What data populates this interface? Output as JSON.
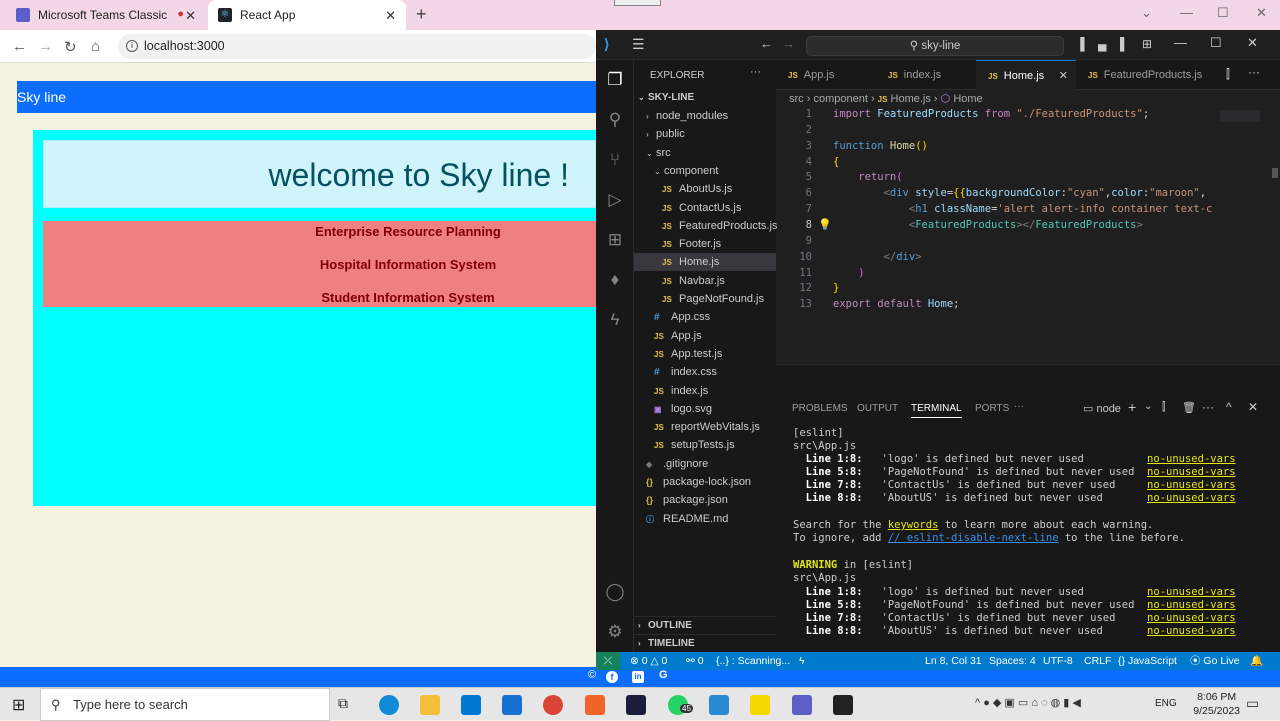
{
  "browser": {
    "tabs": [
      {
        "title": "Microsoft Teams Classic",
        "active": false
      },
      {
        "title": "React App",
        "active": true
      }
    ],
    "url": "localhost:3000"
  },
  "app": {
    "navbar_brand": "Sky line",
    "welcome": "welcome to Sky line !",
    "products": [
      "Enterprise Resource Planning",
      "Hospital Information System",
      "Student Information System"
    ]
  },
  "vscode": {
    "search": "sky-line",
    "explorer_title": "EXPLORER",
    "project": "SKY-LINE",
    "tree": [
      {
        "label": "node_modules",
        "type": "folder",
        "indent": 1
      },
      {
        "label": "public",
        "type": "folder",
        "indent": 1
      },
      {
        "label": "src",
        "type": "folder-open",
        "indent": 1
      },
      {
        "label": "component",
        "type": "folder-open",
        "indent": 2
      },
      {
        "label": "AboutUs.js",
        "type": "js",
        "indent": 3
      },
      {
        "label": "ContactUs.js",
        "type": "js",
        "indent": 3
      },
      {
        "label": "FeaturedProducts.js",
        "type": "js",
        "indent": 3
      },
      {
        "label": "Footer.js",
        "type": "js",
        "indent": 3
      },
      {
        "label": "Home.js",
        "type": "js",
        "indent": 3,
        "selected": true
      },
      {
        "label": "Navbar.js",
        "type": "js",
        "indent": 3
      },
      {
        "label": "PageNotFound.js",
        "type": "js",
        "indent": 3
      },
      {
        "label": "App.css",
        "type": "css",
        "indent": 2
      },
      {
        "label": "App.js",
        "type": "js",
        "indent": 2
      },
      {
        "label": "App.test.js",
        "type": "js",
        "indent": 2
      },
      {
        "label": "index.css",
        "type": "css",
        "indent": 2
      },
      {
        "label": "index.js",
        "type": "js",
        "indent": 2
      },
      {
        "label": "logo.svg",
        "type": "svg",
        "indent": 2
      },
      {
        "label": "reportWebVitals.js",
        "type": "js",
        "indent": 2
      },
      {
        "label": "setupTests.js",
        "type": "js",
        "indent": 2
      },
      {
        "label": ".gitignore",
        "type": "git",
        "indent": 1
      },
      {
        "label": "package-lock.json",
        "type": "json",
        "indent": 1
      },
      {
        "label": "package.json",
        "type": "json",
        "indent": 1
      },
      {
        "label": "README.md",
        "type": "md",
        "indent": 1
      }
    ],
    "outline": "OUTLINE",
    "timeline": "TIMELINE",
    "editor_tabs": [
      "App.js",
      "index.js",
      "Home.js",
      "FeaturedProducts.js"
    ],
    "active_tab": "Home.js",
    "breadcrumb": [
      "src",
      "component",
      "Home.js",
      "Home"
    ],
    "panel_tabs": [
      "PROBLEMS",
      "OUTPUT",
      "TERMINAL",
      "PORTS"
    ],
    "panel_active": "TERMINAL",
    "terminal_shell": "node",
    "status": {
      "errors": "0",
      "warnings": "0",
      "ports": "0",
      "scanning": "{..} : Scanning...",
      "position": "Ln 8, Col 31",
      "spaces": "Spaces: 4",
      "encoding": "UTF-8",
      "eol": "CRLF",
      "language": "JavaScript",
      "golive": "Go Live"
    }
  },
  "taskbar": {
    "search_placeholder": "Type here to search",
    "time": "8:06 PM",
    "date": "9/25/2023",
    "lang": "ENG",
    "whatsapp_badge": "45"
  },
  "colors": {
    "navbar": "#0d6efd",
    "cyan": "#00ffff",
    "product_bg": "#f08080",
    "maroon": "#800000",
    "vscode_status": "#007acc"
  }
}
